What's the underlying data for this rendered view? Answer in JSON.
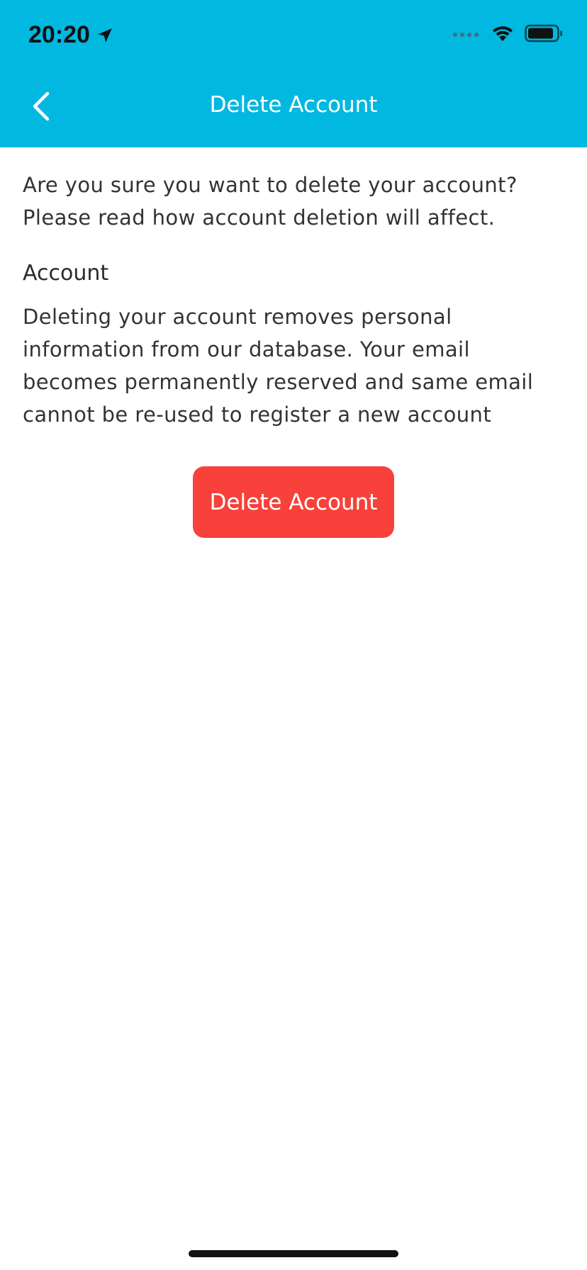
{
  "status_bar": {
    "time": "20:20",
    "location_icon": "location-arrow-icon",
    "signal_icon": "signal-dots-icon",
    "wifi_icon": "wifi-icon",
    "battery_icon": "battery-icon"
  },
  "nav": {
    "back_icon": "chevron-left-icon",
    "title": "Delete Account"
  },
  "content": {
    "intro": "Are you sure you want to delete your account? Please read how account deletion will affect.",
    "section_title": "Account",
    "section_body": "Deleting your account removes personal information from our database. Your email becomes permanently reserved and same email cannot be re-used to register a new account"
  },
  "actions": {
    "delete_label": "Delete Account"
  },
  "colors": {
    "header": "#00B8E0",
    "delete_button": "#F7413A"
  }
}
